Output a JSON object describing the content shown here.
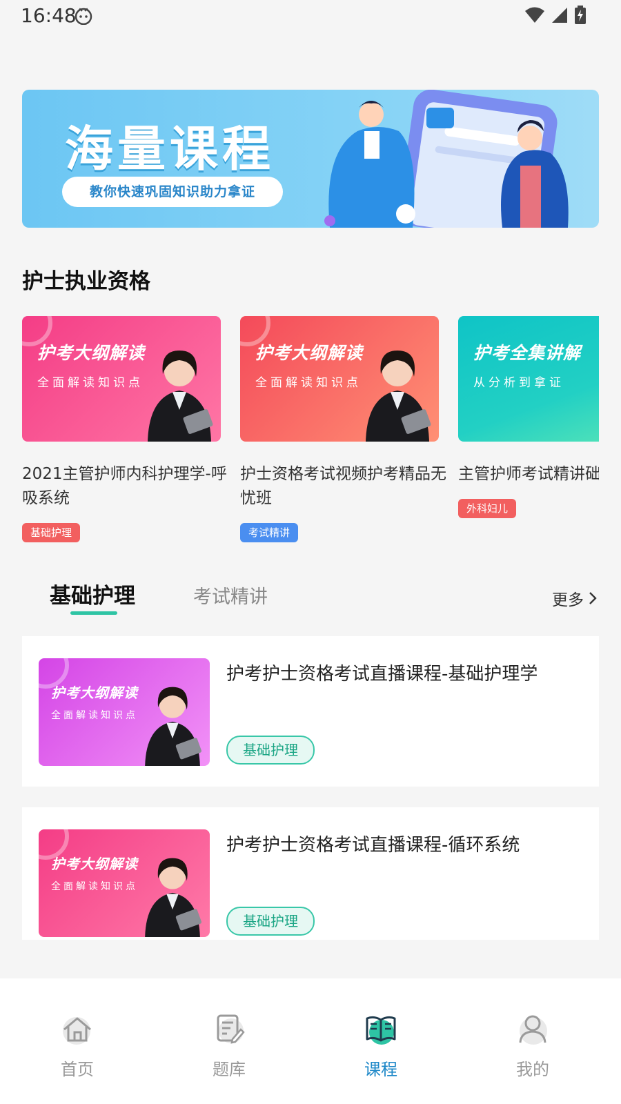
{
  "status_bar": {
    "time": "16:48"
  },
  "banner": {
    "title": "海量课程",
    "subtitle": "教你快速巩固知识助力拿证"
  },
  "section": {
    "title": "护士执业资格"
  },
  "courses": [
    {
      "thumb_title": "护考大纲解读",
      "thumb_sub": "全面解读知识点",
      "name": "2021主管护师内科护理学-呼吸系统",
      "tag": "基础护理",
      "tag_color": "#f25f5f",
      "thumb_gradient": [
        "#f44a8e",
        "#ff7aa8"
      ]
    },
    {
      "thumb_title": "护考大纲解读",
      "thumb_sub": "全面解读知识点",
      "name": "护士资格考试视频护考精品无忧班",
      "tag": "考试精讲",
      "tag_color": "#4a8ef0",
      "thumb_gradient": [
        "#f4525e",
        "#ff8f72"
      ]
    },
    {
      "thumb_title": "护考全集讲解",
      "thumb_sub": "从分析到拿证",
      "name": "主管护师考试精讲础外科妇儿",
      "tag": "外科妇儿",
      "tag_color": "#f25f5f",
      "thumb_gradient": [
        "#12c6c7",
        "#4fe0b8"
      ]
    }
  ],
  "tabs": {
    "active": "基础护理",
    "inactive": "考试精讲",
    "more": "更多"
  },
  "list": [
    {
      "thumb_title": "护考大纲解读",
      "thumb_sub": "全面解读知识点",
      "title": "护考护士资格考试直播课程-基础护理学",
      "tag": "基础护理",
      "thumb_gradient": [
        "#d94ee8",
        "#f08ef5"
      ]
    },
    {
      "thumb_title": "护考大纲解读",
      "thumb_sub": "全面解读知识点",
      "title": "护考护士资格考试直播课程-循环系统",
      "tag": "基础护理",
      "thumb_gradient": [
        "#f44a8e",
        "#ff7aa8"
      ]
    }
  ],
  "nav": {
    "items": [
      {
        "label": "首页",
        "icon": "home-icon"
      },
      {
        "label": "题库",
        "icon": "question-bank-icon"
      },
      {
        "label": "课程",
        "icon": "book-icon"
      },
      {
        "label": "我的",
        "icon": "user-icon"
      }
    ],
    "active_index": 2,
    "active_color": "#1e88c8",
    "accent": "#2ec4a4"
  }
}
